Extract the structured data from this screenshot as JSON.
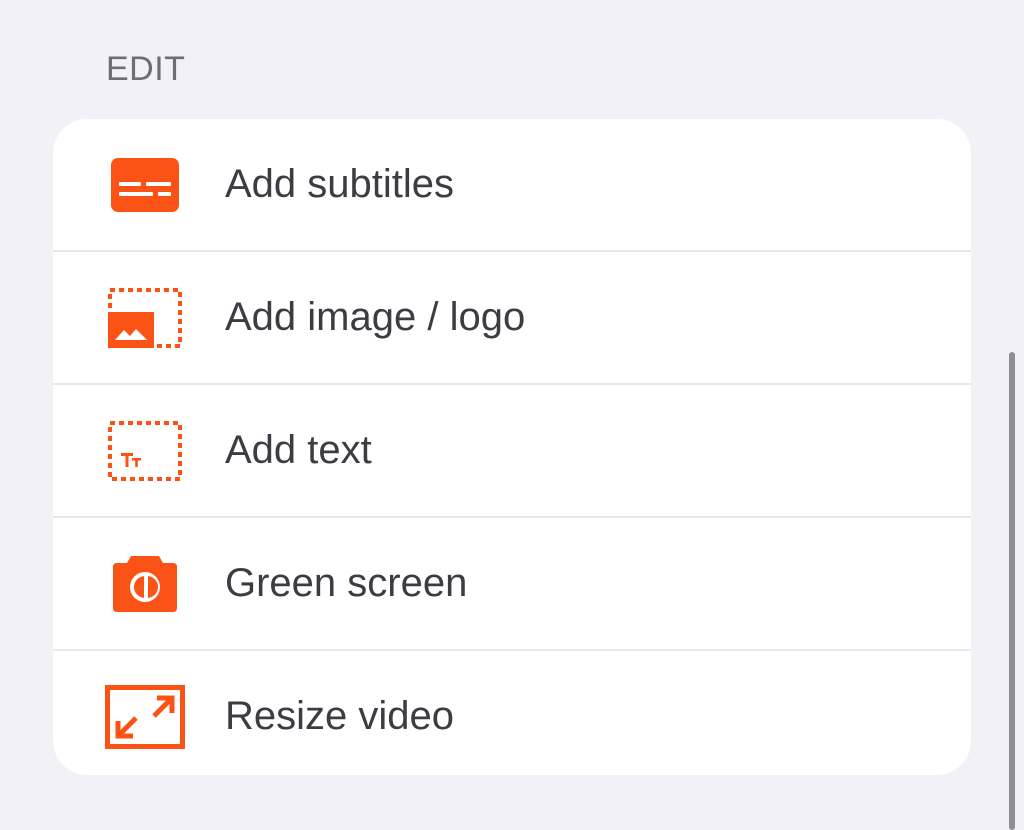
{
  "section": {
    "title": "EDIT"
  },
  "colors": {
    "accent": "#fb5316",
    "background": "#f2f1f6",
    "card": "#ffffff",
    "label": "#3c3c43",
    "header": "#6d6d72"
  },
  "items": [
    {
      "label": "Add subtitles",
      "icon": "subtitles-icon"
    },
    {
      "label": "Add image / logo",
      "icon": "image-logo-icon"
    },
    {
      "label": "Add text",
      "icon": "text-icon"
    },
    {
      "label": "Green screen",
      "icon": "green-screen-icon"
    },
    {
      "label": "Resize video",
      "icon": "resize-icon"
    }
  ],
  "scrollbar": {
    "visible": true
  }
}
